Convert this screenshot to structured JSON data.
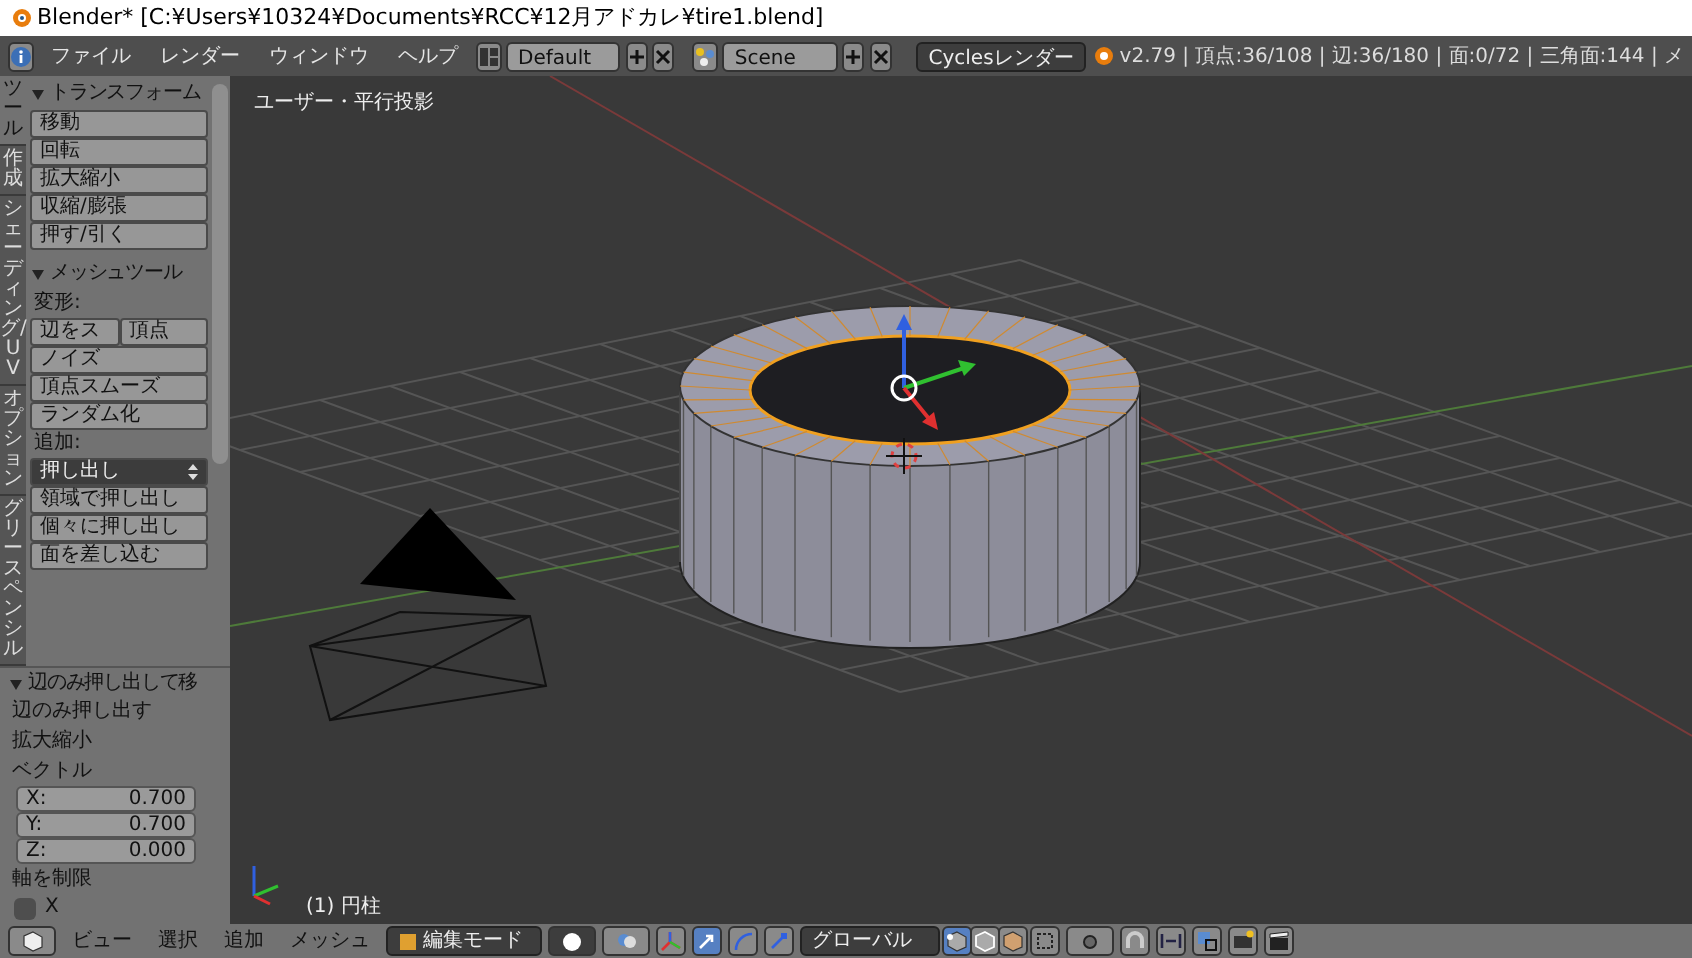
{
  "window": {
    "title": "Blender* [C:¥Users¥10324¥Documents¥RCC¥12月アドカレ¥tire1.blend]"
  },
  "menu_bar": {
    "menus": [
      "ファイル",
      "レンダー",
      "ウィンドウ",
      "ヘルプ"
    ],
    "screen_layout": "Default",
    "scene": "Scene",
    "render_engine": "Cyclesレンダー",
    "stats": "v2.79 | 頂点:36/108 | 辺:36/180 | 面:0/72 | 三角面:144 | メ"
  },
  "tool_shelf": {
    "tabs": [
      {
        "label": "ツール",
        "selected": true
      },
      {
        "label": "作成",
        "selected": false
      },
      {
        "label": "シェーディング/UV",
        "selected": false
      },
      {
        "label": "オプション",
        "selected": false
      },
      {
        "label": "グリースペンシル",
        "selected": false
      }
    ],
    "panels": [
      {
        "title": "トランスフォーム",
        "expanded": true,
        "items": [
          {
            "kind": "button",
            "label": "移動"
          },
          {
            "kind": "button",
            "label": "回転"
          },
          {
            "kind": "button",
            "label": "拡大縮小"
          },
          {
            "kind": "button",
            "label": "収縮/膨張"
          },
          {
            "kind": "button",
            "label": "押す/引く"
          }
        ]
      },
      {
        "title": "メッシュツール",
        "expanded": true,
        "items": [
          {
            "kind": "label",
            "label": "変形:"
          },
          {
            "kind": "button_row",
            "labels": [
              "辺をス",
              "頂点"
            ]
          },
          {
            "kind": "button",
            "label": "ノイズ"
          },
          {
            "kind": "button",
            "label": "頂点スムーズ"
          },
          {
            "kind": "button",
            "label": "ランダム化"
          },
          {
            "kind": "label",
            "label": "追加:"
          },
          {
            "kind": "dropdown",
            "label": "押し出し"
          },
          {
            "kind": "button",
            "label": "領域で押し出し"
          },
          {
            "kind": "button",
            "label": "個々に押し出し"
          },
          {
            "kind": "button",
            "label": "面を差し込む"
          }
        ]
      }
    ]
  },
  "operator_panel": {
    "title": "辺のみ押し出して移",
    "expanded": true,
    "items": [
      {
        "kind": "label",
        "label": "辺のみ押し出す"
      },
      {
        "kind": "label",
        "label": "拡大縮小"
      },
      {
        "kind": "label",
        "label": "ベクトル"
      },
      {
        "kind": "number",
        "label": "X:",
        "value": "0.700"
      },
      {
        "kind": "number",
        "label": "Y:",
        "value": "0.700"
      },
      {
        "kind": "number",
        "label": "Z:",
        "value": "0.000"
      },
      {
        "kind": "label",
        "label": "軸を制限"
      },
      {
        "kind": "checkbox",
        "label": "X",
        "checked": false
      }
    ]
  },
  "viewport": {
    "view_label": "ユーザー・平行投影",
    "object_label": "(1) 円柱"
  },
  "bottom_bar": {
    "menus": [
      "ビュー",
      "選択",
      "追加",
      "メッシュ"
    ],
    "mode": "編集モード",
    "orientation": "グローバル",
    "transform_tools": [
      {
        "kind": "translate",
        "selected": true
      },
      {
        "kind": "rotate",
        "selected": false
      },
      {
        "kind": "scale",
        "selected": false
      }
    ],
    "select_modes": [
      {
        "kind": "vertex",
        "selected": true
      },
      {
        "kind": "edge",
        "selected": false
      },
      {
        "kind": "face",
        "selected": false
      }
    ]
  }
}
